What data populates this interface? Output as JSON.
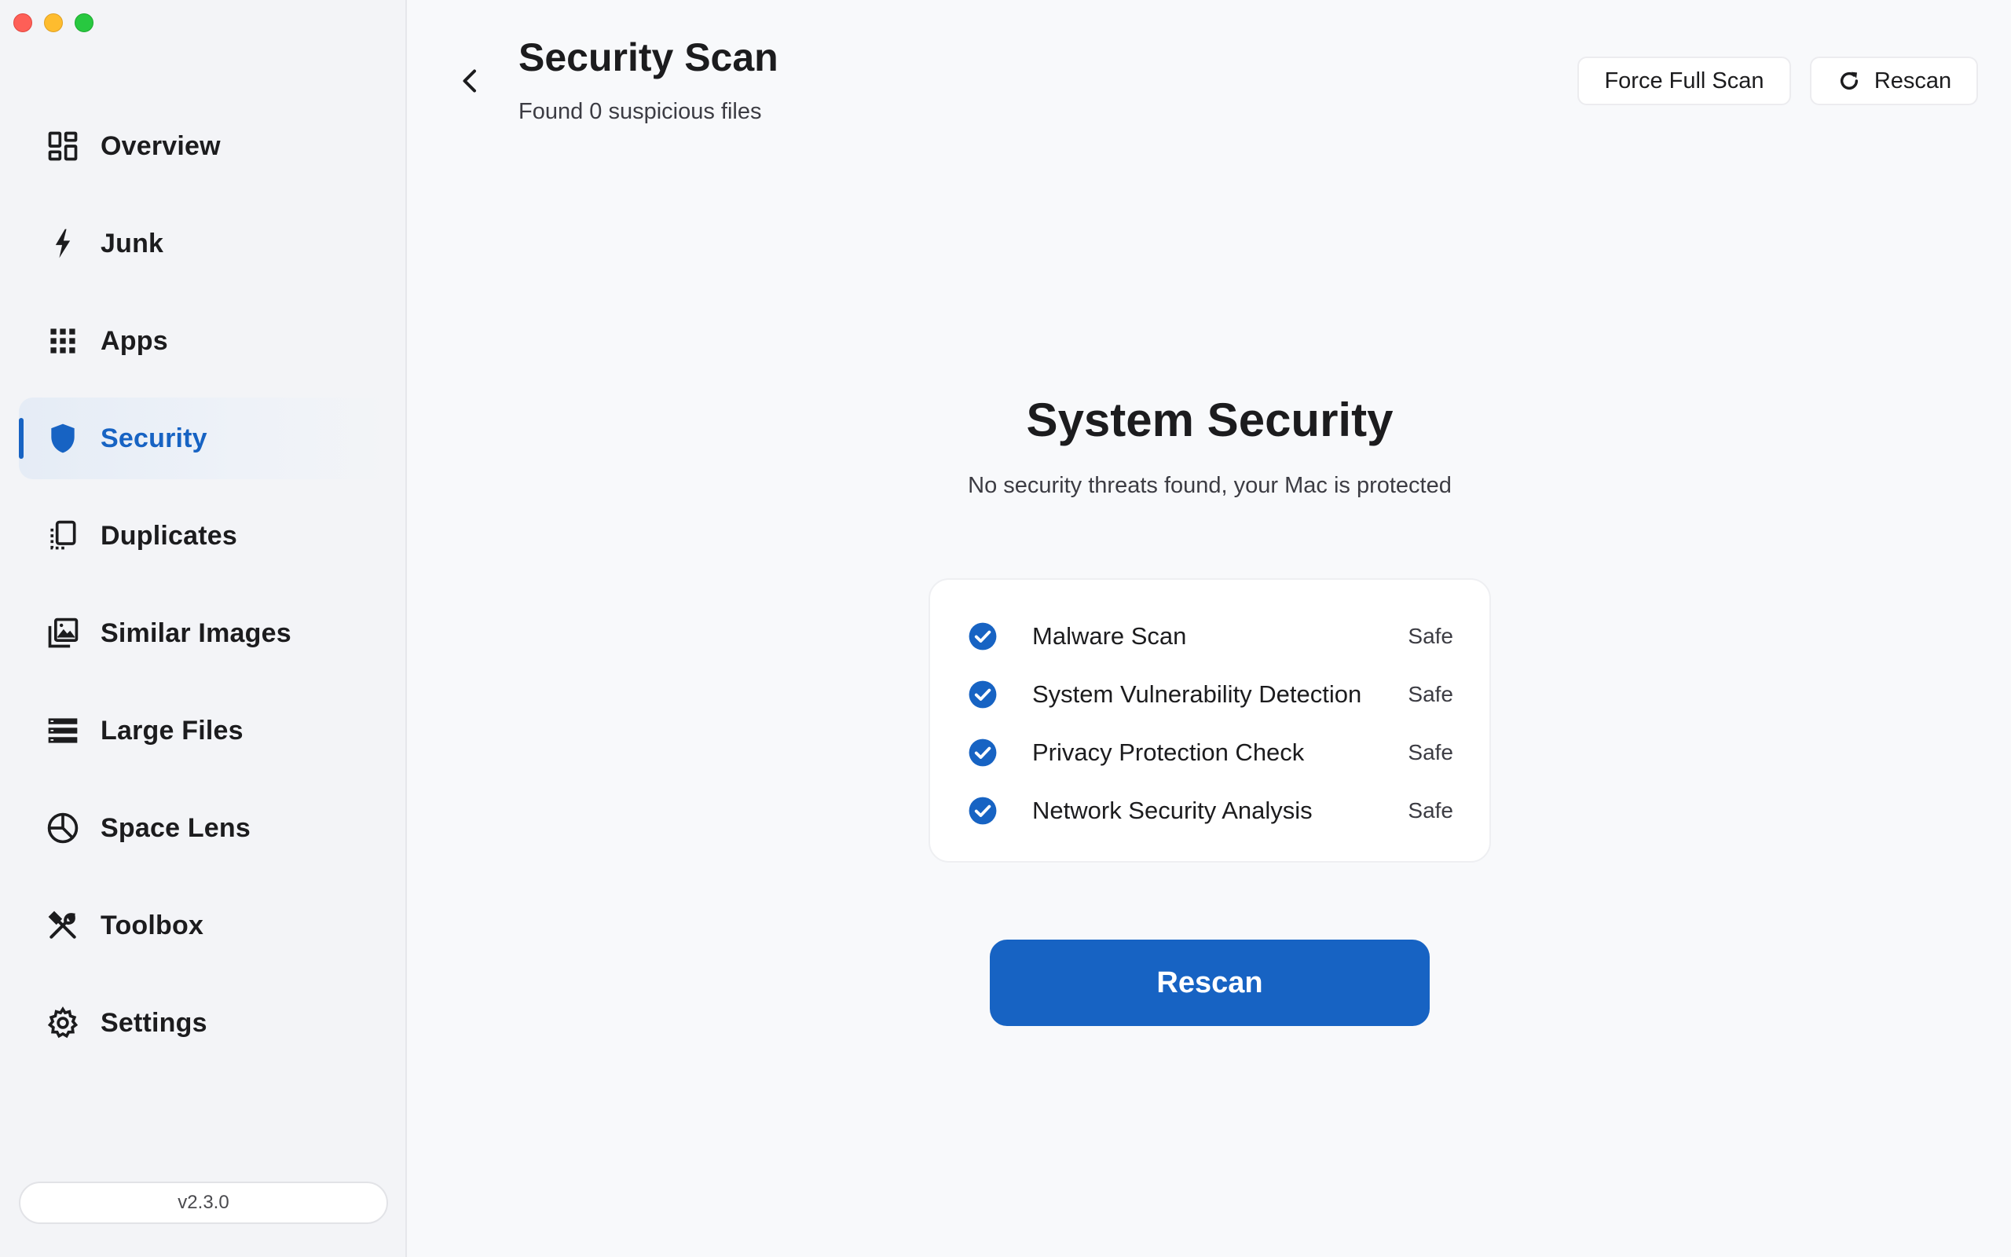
{
  "window": {
    "controls": [
      "close",
      "minimize",
      "maximize"
    ]
  },
  "sidebar": {
    "items": [
      {
        "label": "Overview",
        "icon": "overview-icon"
      },
      {
        "label": "Junk",
        "icon": "bolt-icon"
      },
      {
        "label": "Apps",
        "icon": "apps-grid-icon"
      },
      {
        "label": "Security",
        "icon": "shield-icon",
        "active": true
      },
      {
        "label": "Duplicates",
        "icon": "duplicates-icon"
      },
      {
        "label": "Similar Images",
        "icon": "image-stack-icon"
      },
      {
        "label": "Large Files",
        "icon": "large-files-icon"
      },
      {
        "label": "Space Lens",
        "icon": "pie-chart-icon"
      },
      {
        "label": "Toolbox",
        "icon": "tools-icon"
      },
      {
        "label": "Settings",
        "icon": "gear-icon"
      }
    ],
    "version": "v2.3.0"
  },
  "header": {
    "title": "Security Scan",
    "subtitle": "Found 0 suspicious files",
    "force_full_scan_label": "Force Full Scan",
    "rescan_label": "Rescan"
  },
  "main": {
    "title": "System Security",
    "subtitle": "No security threats found, your Mac is protected",
    "checks": [
      {
        "label": "Malware Scan",
        "status": "Safe"
      },
      {
        "label": "System Vulnerability Detection",
        "status": "Safe"
      },
      {
        "label": "Privacy Protection Check",
        "status": "Safe"
      },
      {
        "label": "Network Security Analysis",
        "status": "Safe"
      }
    ],
    "rescan_button_label": "Rescan"
  },
  "colors": {
    "accent": "#1763c3",
    "sidebar_bg": "#f3f4f7",
    "main_bg": "#f8f9fb"
  }
}
